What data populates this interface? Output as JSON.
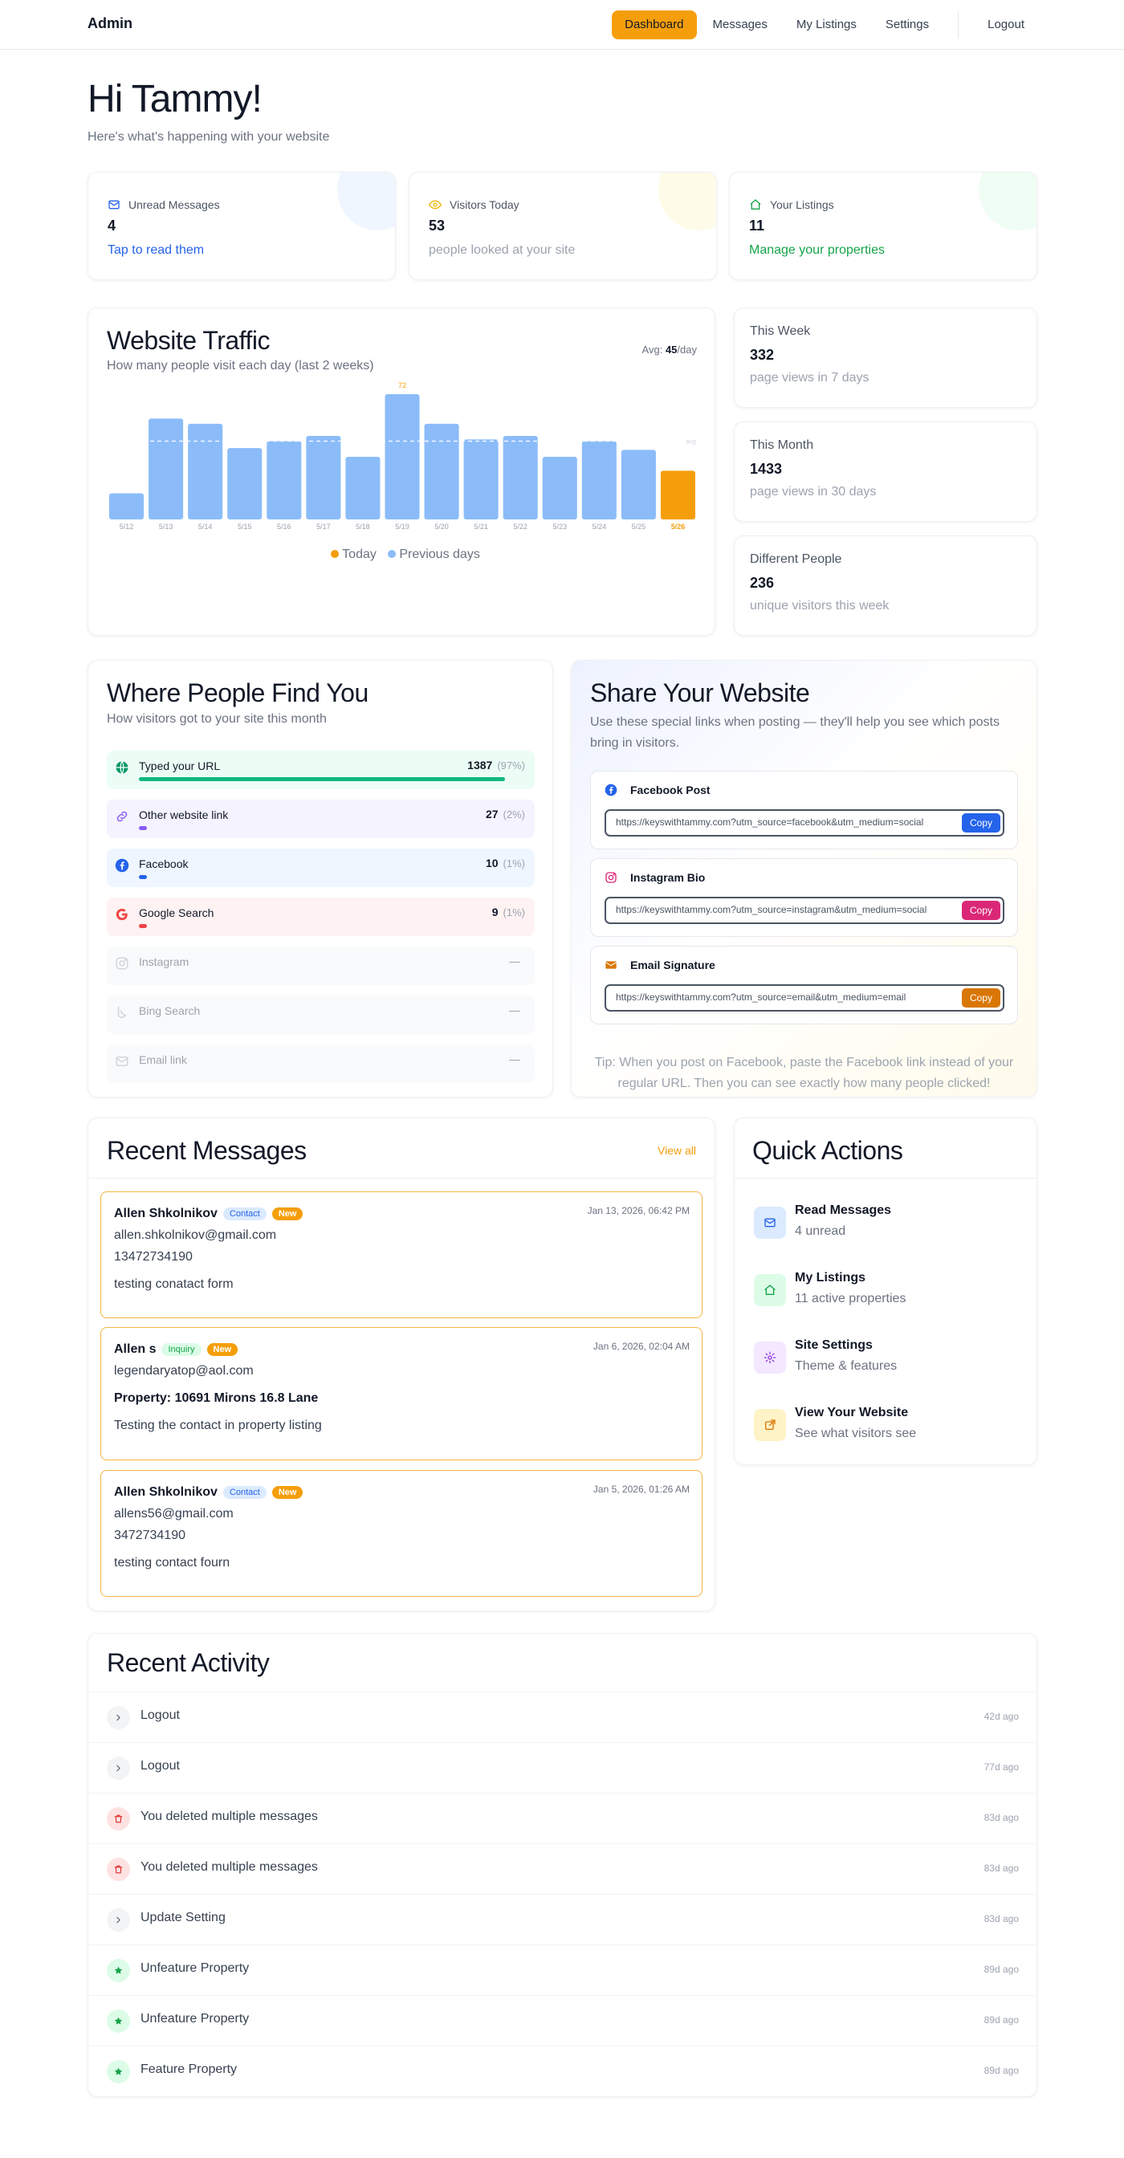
{
  "nav": {
    "brand": "Admin",
    "links": [
      "Dashboard",
      "Messages",
      "My Listings",
      "Settings"
    ],
    "logout": "Logout"
  },
  "greeting": {
    "title": "Hi Tammy!",
    "subtitle": "Here's what's happening with your website"
  },
  "stats": [
    {
      "label": "Unread Messages",
      "value": "4",
      "link": "Tap to read them",
      "color": "#2563eb",
      "icon": "mail-icon"
    },
    {
      "label": "Visitors Today",
      "value": "53",
      "link": "people looked at your site",
      "color": "#eab308",
      "icon": "eye-icon"
    },
    {
      "label": "Your Listings",
      "value": "11",
      "link": "Manage your properties",
      "color": "#16a34a",
      "icon": "house-icon"
    }
  ],
  "traffic": {
    "title": "Website Traffic",
    "subtitle": "How many people visit each day (last 2 weeks)",
    "avg_prefix": "Avg:",
    "avg_value": "45",
    "avg_suffix": "/day",
    "avg_tag": "avg",
    "legend_today": "Today",
    "legend_prev": "Previous days",
    "peak_label": "72"
  },
  "chart_data": {
    "type": "bar",
    "categories": [
      "5/12",
      "5/13",
      "5/14",
      "5/15",
      "5/16",
      "5/17",
      "5/18",
      "5/19",
      "5/20",
      "5/21",
      "5/22",
      "5/23",
      "5/24",
      "5/25",
      "5/26"
    ],
    "series": [
      {
        "name": "Previous days",
        "values": [
          15,
          58,
          55,
          41,
          45,
          48,
          36,
          72,
          55,
          46,
          48,
          36,
          45,
          40,
          null
        ]
      },
      {
        "name": "Today",
        "values": [
          null,
          null,
          null,
          null,
          null,
          null,
          null,
          null,
          null,
          null,
          null,
          null,
          null,
          null,
          28
        ]
      }
    ],
    "avg": 45,
    "ylim": [
      0,
      72
    ],
    "colors": {
      "previous": "#8bbcf9",
      "today": "#f59e0b"
    }
  },
  "mini_stats": [
    {
      "label": "This Week",
      "value": "332",
      "sub": "page views in 7 days"
    },
    {
      "label": "This Month",
      "value": "1433",
      "sub": "page views in 30 days"
    },
    {
      "label": "Different People",
      "value": "236",
      "sub": "unique visitors this week"
    }
  ],
  "sources": {
    "title": "Where People Find You",
    "subtitle": "How visitors got to your site this month",
    "items": [
      {
        "name": "Typed your URL",
        "count": "1387",
        "pct": "(97%)",
        "fraction": 0.97,
        "bg": "#ecfdf5",
        "bar": "#10b981",
        "icon": "globe-icon",
        "dim": false
      },
      {
        "name": "Other website link",
        "count": "27",
        "pct": "(2%)",
        "fraction": 0.02,
        "bg": "#f5f3ff",
        "bar": "#8b5cf6",
        "icon": "link-icon",
        "dim": false
      },
      {
        "name": "Facebook",
        "count": "10",
        "pct": "(1%)",
        "fraction": 0.01,
        "bg": "#eff6ff",
        "bar": "#2563eb",
        "icon": "facebook-icon",
        "dim": false
      },
      {
        "name": "Google Search",
        "count": "9",
        "pct": "(1%)",
        "fraction": 0.01,
        "bg": "#fef2f2",
        "bar": "#ef4444",
        "icon": "google-icon",
        "dim": false
      },
      {
        "name": "Instagram",
        "count": "—",
        "pct": "",
        "fraction": 0,
        "bg": "#f9fafb",
        "bar": "#d1d5db",
        "icon": "instagram-icon",
        "dim": true
      },
      {
        "name": "Bing Search",
        "count": "—",
        "pct": "",
        "fraction": 0,
        "bg": "#f9fafb",
        "bar": "#d1d5db",
        "icon": "bing-icon",
        "dim": true
      },
      {
        "name": "Email link",
        "count": "—",
        "pct": "",
        "fraction": 0,
        "bg": "#f9fafb",
        "bar": "#d1d5db",
        "icon": "email-icon",
        "dim": true
      }
    ]
  },
  "share": {
    "title": "Share Your Website",
    "subtitle": "Use these special links when posting — they'll help you see which posts bring in visitors.",
    "links": [
      {
        "label": "Facebook Post",
        "url": "https://keyswithtammy.com?utm_source=facebook&utm_medium=social",
        "copy": "Copy",
        "color": "#2563eb",
        "icon": "facebook-icon"
      },
      {
        "label": "Instagram Bio",
        "url": "https://keyswithtammy.com?utm_source=instagram&utm_medium=social",
        "copy": "Copy",
        "color": "#db2777",
        "icon": "instagram-icon"
      },
      {
        "label": "Email Signature",
        "url": "https://keyswithtammy.com?utm_source=email&utm_medium=email",
        "copy": "Copy",
        "color": "#d97706",
        "icon": "envelope-icon"
      }
    ],
    "tip": "Tip: When you post on Facebook, paste the Facebook link instead of your regular URL. Then you can see exactly how many people clicked!"
  },
  "messages": {
    "title": "Recent Messages",
    "view_all": "View all",
    "items": [
      {
        "name": "Allen Shkolnikov",
        "type": "Contact",
        "status": "New",
        "date": "Jan 13, 2026, 06:42 PM",
        "email": "allen.shkolnikov@gmail.com",
        "detail": "13472734190",
        "detail_bold": false,
        "body": "testing conatact form"
      },
      {
        "name": "Allen s",
        "type": "Inquiry",
        "status": "New",
        "date": "Jan 6, 2026, 02:04 AM",
        "email": "legendaryatop@aol.com",
        "detail": "Property: 10691 Mirons 16.8 Lane",
        "detail_bold": true,
        "body": "Testing the contact in property listing"
      },
      {
        "name": "Allen Shkolnikov",
        "type": "Contact",
        "status": "New",
        "date": "Jan 5, 2026, 01:26 AM",
        "email": "allens56@gmail.com",
        "detail": "3472734190",
        "detail_bold": false,
        "body": "testing contact fourn"
      }
    ]
  },
  "quick_actions": {
    "title": "Quick Actions",
    "items": [
      {
        "title": "Read Messages",
        "sub": "4 unread",
        "bg": "#dbeafe",
        "color": "#2563eb",
        "icon": "mail-icon"
      },
      {
        "title": "My Listings",
        "sub": "11 active properties",
        "bg": "#dcfce7",
        "color": "#16a34a",
        "icon": "house-icon"
      },
      {
        "title": "Site Settings",
        "sub": "Theme & features",
        "bg": "#f3e8ff",
        "color": "#9333ea",
        "icon": "gear-icon"
      },
      {
        "title": "View Your Website",
        "sub": "See what visitors see",
        "bg": "#fef3c7",
        "color": "#d97706",
        "icon": "external-link-icon"
      }
    ]
  },
  "activity": {
    "title": "Recent Activity",
    "items": [
      {
        "text": "Logout",
        "time": "42d ago",
        "kind": "chevron"
      },
      {
        "text": "Logout",
        "time": "77d ago",
        "kind": "chevron"
      },
      {
        "text": "You deleted multiple messages",
        "time": "83d ago",
        "kind": "trash"
      },
      {
        "text": "You deleted multiple messages",
        "time": "83d ago",
        "kind": "trash"
      },
      {
        "text": "Update Setting",
        "time": "83d ago",
        "kind": "chevron"
      },
      {
        "text": "Unfeature Property",
        "time": "89d ago",
        "kind": "star"
      },
      {
        "text": "Unfeature Property",
        "time": "89d ago",
        "kind": "star"
      },
      {
        "text": "Feature Property",
        "time": "89d ago",
        "kind": "star"
      }
    ]
  }
}
